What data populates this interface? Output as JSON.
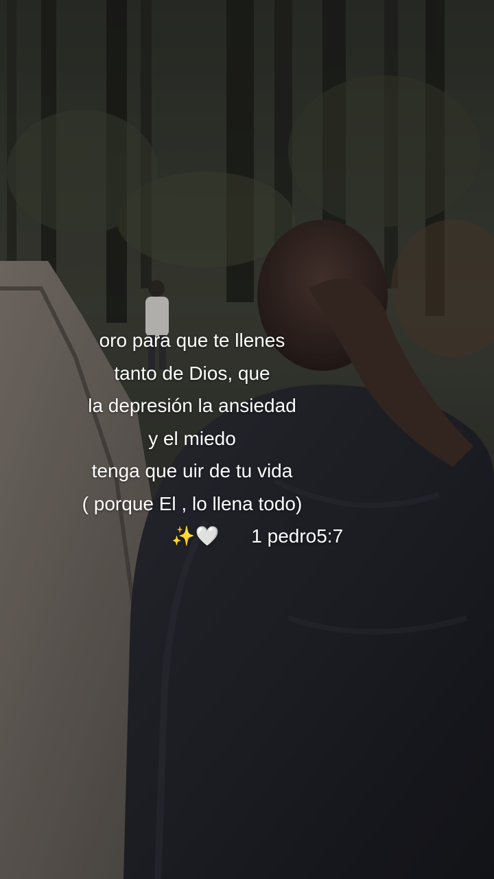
{
  "caption": {
    "lines": [
      "oro para que te llenes",
      "tanto de Dios, que",
      "la depresión la ansiedad",
      "y el miedo",
      "tenga que uir de tu vida",
      "( porque El , lo llena todo)"
    ],
    "emoji": "✨🤍",
    "reference": "1 pedro5:7"
  },
  "colors": {
    "caption_text": "#ffffff",
    "forest_dark": "#23251f",
    "jacket": "#1c1d24",
    "hair": "#3a2a24",
    "path": "#6a645e"
  }
}
